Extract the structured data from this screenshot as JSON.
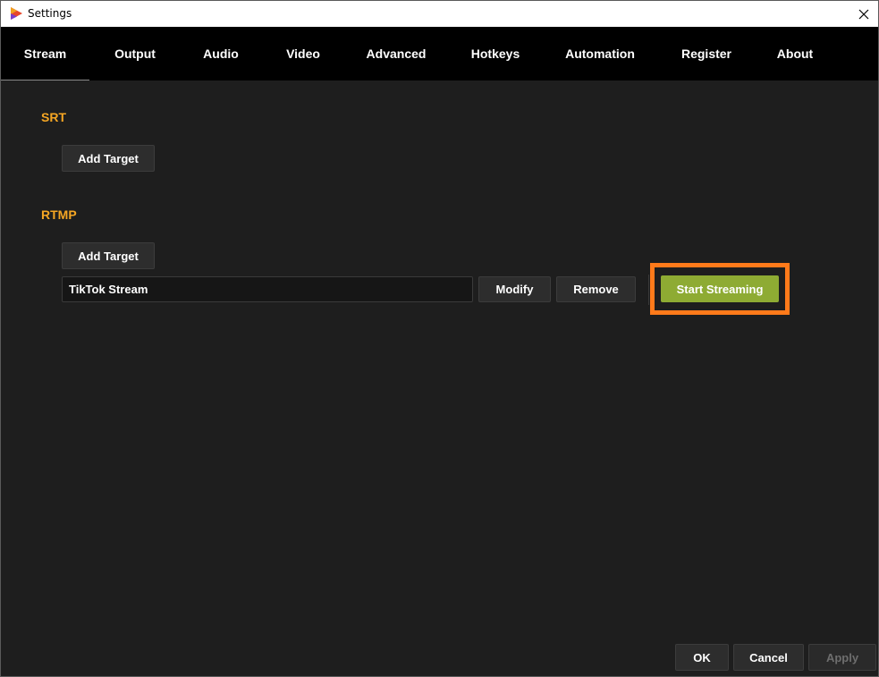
{
  "window": {
    "title": "Settings"
  },
  "tabs": [
    {
      "label": "Stream",
      "active": true
    },
    {
      "label": "Output"
    },
    {
      "label": "Audio"
    },
    {
      "label": "Video"
    },
    {
      "label": "Advanced"
    },
    {
      "label": "Hotkeys"
    },
    {
      "label": "Automation"
    },
    {
      "label": "Register"
    },
    {
      "label": "About"
    }
  ],
  "srt": {
    "title": "SRT",
    "add_target_label": "Add Target"
  },
  "rtmp": {
    "title": "RTMP",
    "add_target_label": "Add Target",
    "targets": [
      {
        "name": "TikTok Stream",
        "modify_label": "Modify",
        "remove_label": "Remove",
        "start_label": "Start Streaming"
      }
    ]
  },
  "footer": {
    "ok_label": "OK",
    "cancel_label": "Cancel",
    "apply_label": "Apply",
    "apply_enabled": false
  },
  "colors": {
    "accent_orange": "#f5a623",
    "highlight_orange": "#ff7a1a",
    "start_green": "#8eab33",
    "background": "#1e1e1e",
    "tab_bar": "#000000"
  },
  "icons": {
    "app": "app-logo-icon",
    "close": "close-icon"
  }
}
